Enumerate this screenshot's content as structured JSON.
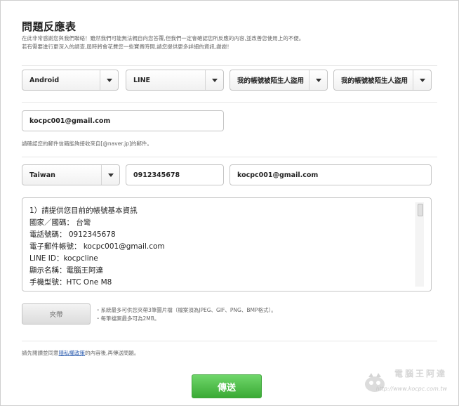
{
  "form": {
    "title": "問題反應表",
    "intro_line1": "在此非常感謝您與我們聯絡！雖然我們可能無法親自向您答覆,但我們一定會確認您所反應的內容,並改善您使用上的不便。",
    "intro_line2": "若有需要進行更深入的調查,屆時將會花費您一些寶貴時間,請您提供更多詳細的資訊,謝謝！"
  },
  "selects": {
    "os": "Android",
    "app": "LINE",
    "category": "我的帳號被陌生人盜用",
    "subcategory": "我的帳號被陌生人盜用"
  },
  "email_confirm": {
    "value": "kocpc001@gmail.com",
    "help": "請確認您的郵件信箱能夠接收來自[@naver.jp]的郵件。"
  },
  "contact": {
    "country": "Taiwan",
    "phone": "0912345678",
    "email": "kocpc001@gmail.com"
  },
  "message": {
    "lines": [
      "1）請提供您目前的帳號基本資訊",
      "國家／國碼： 台彎",
      "電話號碼： 0912345678",
      "電子郵件帳號： kocpc001@gmail.com",
      "LINE ID：kocpcline",
      "顯示名稱：電腦王阿達",
      "手機型號：HTC One M8"
    ]
  },
  "attachment": {
    "button_label": "夾帶",
    "note1": "・系統最多可供您夾帶3筆圖片檔（檔案須為JPEG、GIF、PNG、BMP格式）。",
    "note2": "・每筆檔案最多可為2MB。"
  },
  "agreement": {
    "prefix": "請先閱讀並同意",
    "link": "隱私權政策",
    "suffix": "的內容後,再傳送問題。"
  },
  "submit": {
    "label": "傳送"
  },
  "watermark": {
    "text": "電腦王阿達",
    "url": "http://www.kocpc.com.tw"
  },
  "colors": {
    "accent_green": "#3aaa35",
    "link_blue": "#2f5fb0"
  }
}
